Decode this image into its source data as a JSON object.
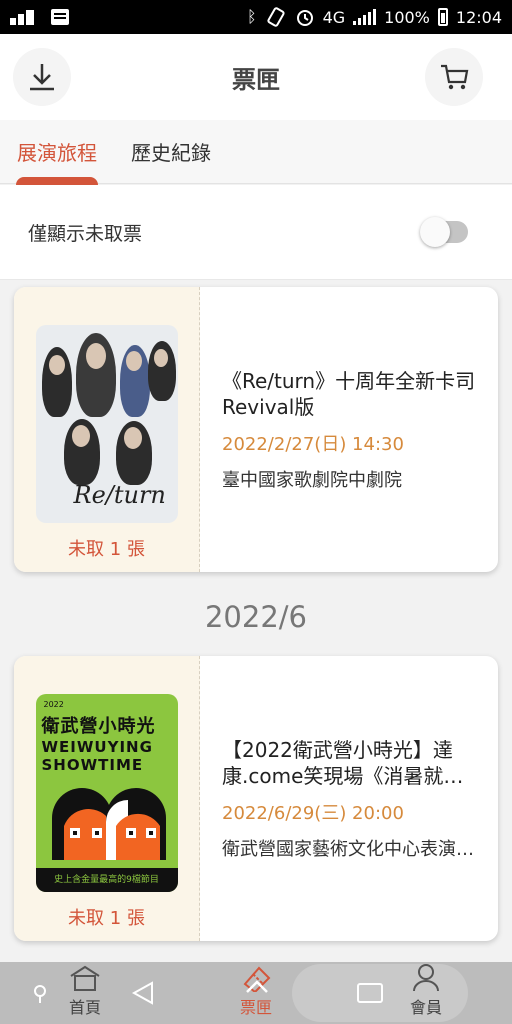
{
  "status_bar": {
    "network": "4G",
    "battery": "100%",
    "time": "12:04"
  },
  "header": {
    "title": "票匣",
    "download_icon": "download-icon",
    "cart_icon": "cart-icon"
  },
  "tabs": [
    {
      "label": "展演旅程",
      "active": true
    },
    {
      "label": "歷史紀錄",
      "active": false
    }
  ],
  "filter": {
    "label": "僅顯示未取票",
    "toggle_on": false
  },
  "tickets": [
    {
      "title": "《Re/turn》十周年全新卡司Revival版",
      "date": "2022/2/27(日) 14:30",
      "venue": "臺中國家歌劇院中劇院",
      "status": "未取 1 張",
      "poster_text": "Re/turn"
    },
    {
      "title": "【2022衛武營小時光】達康.come笑現場《消暑就…",
      "date": "2022/6/29(三) 20:00",
      "venue": "衛武營國家藝術文化中心表演…",
      "status": "未取 1 張",
      "poster_year": "2022",
      "poster_cn": "衛武營小時光",
      "poster_en_1": "WEIWUYING",
      "poster_en_2": "SHOWTIME",
      "poster_bottom": "史上含金量最高的9檔節目"
    }
  ],
  "section_date": "2022/6",
  "bottom_nav": [
    {
      "label": "首頁",
      "icon": "home-icon"
    },
    {
      "label": "票匣",
      "icon": "ticket-icon",
      "active": true
    },
    {
      "label": "會員",
      "icon": "member-icon"
    }
  ],
  "colors": {
    "accent": "#d3553a",
    "date": "#d68a3c",
    "stub_bg": "#fbf5e8"
  }
}
